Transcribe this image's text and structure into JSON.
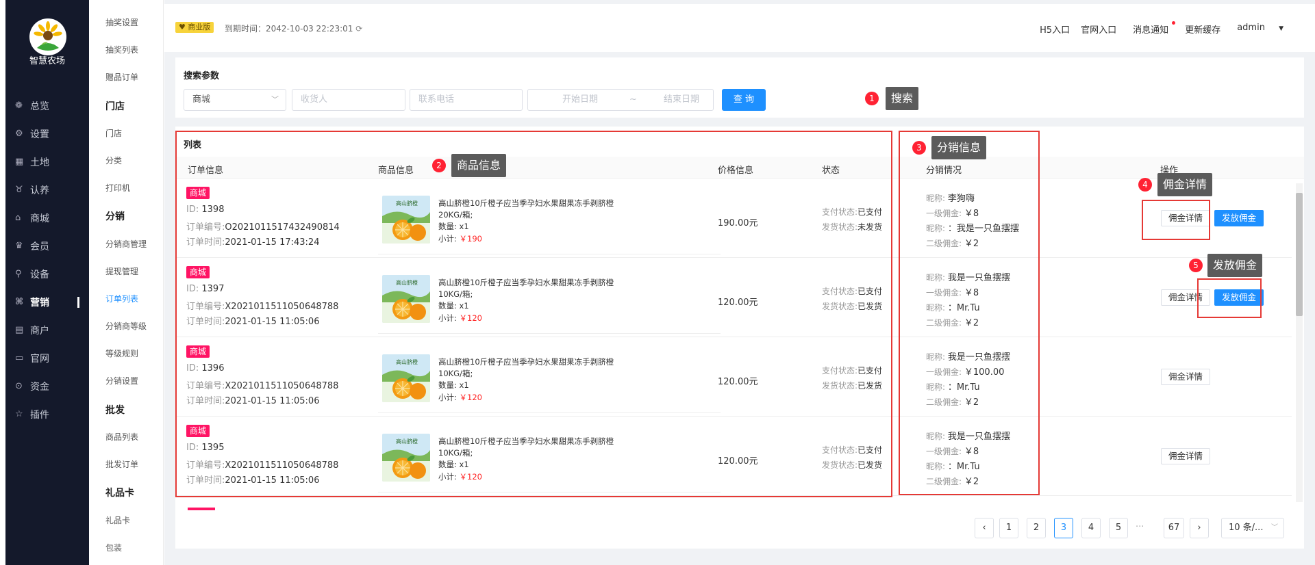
{
  "app": {
    "name": "智慧农场"
  },
  "sidebar": {
    "items": [
      {
        "icon": "dashboard-icon",
        "glyph": "❁",
        "label": "总览"
      },
      {
        "icon": "gear-icon",
        "glyph": "⚙",
        "label": "设置"
      },
      {
        "icon": "grid-icon",
        "glyph": "▦",
        "label": "土地"
      },
      {
        "icon": "animal-icon",
        "glyph": "♉",
        "label": "认养"
      },
      {
        "icon": "shop-icon",
        "glyph": "⌂",
        "label": "商城"
      },
      {
        "icon": "crown-icon",
        "glyph": "♛",
        "label": "会员"
      },
      {
        "icon": "device-icon",
        "glyph": "⚲",
        "label": "设备"
      },
      {
        "icon": "marketing-icon",
        "glyph": "⌘",
        "label": "营销"
      },
      {
        "icon": "merchant-icon",
        "glyph": "▤",
        "label": "商户"
      },
      {
        "icon": "website-icon",
        "glyph": "▭",
        "label": "官网"
      },
      {
        "icon": "money-icon",
        "glyph": "⊙",
        "label": "资金"
      },
      {
        "icon": "plugin-icon",
        "glyph": "☆",
        "label": "插件"
      }
    ],
    "active_index": 7
  },
  "subnav": {
    "items": [
      {
        "label": "抽奖设置",
        "type": "item"
      },
      {
        "label": "抽奖列表",
        "type": "item"
      },
      {
        "label": "赠品订单",
        "type": "item"
      },
      {
        "label": "门店",
        "type": "head"
      },
      {
        "label": "门店",
        "type": "item"
      },
      {
        "label": "分类",
        "type": "item"
      },
      {
        "label": "打印机",
        "type": "item"
      },
      {
        "label": "分销",
        "type": "head"
      },
      {
        "label": "分销商管理",
        "type": "item"
      },
      {
        "label": "提现管理",
        "type": "item"
      },
      {
        "label": "订单列表",
        "type": "active"
      },
      {
        "label": "分销商等级",
        "type": "item"
      },
      {
        "label": "等级规则",
        "type": "item"
      },
      {
        "label": "分销设置",
        "type": "item"
      },
      {
        "label": "批发",
        "type": "head"
      },
      {
        "label": "商品列表",
        "type": "item"
      },
      {
        "label": "批发订单",
        "type": "item"
      },
      {
        "label": "礼品卡",
        "type": "head"
      },
      {
        "label": "礼品卡",
        "type": "item"
      },
      {
        "label": "包装",
        "type": "item"
      }
    ]
  },
  "header": {
    "edition": "商业版",
    "expire_label": "到期时间：2042-10-03 22:23:01",
    "links": [
      "H5入口",
      "官网入口",
      "消息通知",
      "更新缓存",
      "admin"
    ]
  },
  "search": {
    "title": "搜索参数",
    "type_value": "商城",
    "receiver_placeholder": "收货人",
    "phone_placeholder": "联系电话",
    "start_placeholder": "开始日期",
    "range_sep": "~",
    "end_placeholder": "结束日期",
    "query_button": "查 询"
  },
  "list": {
    "title": "列表",
    "headers": {
      "order": "订单信息",
      "goods": "商品信息",
      "price": "价格信息",
      "status": "状态",
      "distribution": "分销情况",
      "actions": "操作"
    },
    "orders": [
      {
        "tag": "商城",
        "id": "1398",
        "order_no": "O2021011517432490814",
        "time": "2021-01-15 17:43:24",
        "goods_name": "高山脐橙10斤橙子应当季孕妇水果甜果冻手剥脐橙",
        "spec": "20KG/箱;",
        "qty": "x1",
        "subtotal": "￥190",
        "price": "190.00元",
        "pay_status": "已支付",
        "ship_status": "未发货",
        "d1_name": "李狗嗨",
        "d1_comm": "￥8",
        "d2_name": "：我是一只鱼摆摆",
        "d2_comm": "￥2"
      },
      {
        "tag": "商城",
        "id": "1397",
        "order_no": "X2021011511050648788",
        "time": "2021-01-15 11:05:06",
        "goods_name": "高山脐橙10斤橙子应当季孕妇水果甜果冻手剥脐橙",
        "spec": "10KG/箱;",
        "qty": "x1",
        "subtotal": "￥120",
        "price": "120.00元",
        "pay_status": "已支付",
        "ship_status": "已发货",
        "d1_name": "我是一只鱼摆摆",
        "d1_comm": "￥8",
        "d2_name": "：Mr.Tu",
        "d2_comm": "￥2"
      },
      {
        "tag": "商城",
        "id": "1396",
        "order_no": "X2021011511050648788",
        "time": "2021-01-15 11:05:06",
        "goods_name": "高山脐橙10斤橙子应当季孕妇水果甜果冻手剥脐橙",
        "spec": "10KG/箱;",
        "qty": "x1",
        "subtotal": "￥120",
        "price": "120.00元",
        "pay_status": "已支付",
        "ship_status": "已发货",
        "d1_name": "我是一只鱼摆摆",
        "d1_comm": "￥100.00",
        "d2_name": "：Mr.Tu",
        "d2_comm": "￥2"
      },
      {
        "tag": "商城",
        "id": "1395",
        "order_no": "X2021011511050648788",
        "time": "2021-01-15 11:05:06",
        "goods_name": "高山脐橙10斤橙子应当季孕妇水果甜果冻手剥脐橙",
        "spec": "10KG/箱;",
        "qty": "x1",
        "subtotal": "￥120",
        "price": "120.00元",
        "pay_status": "已支付",
        "ship_status": "已发货",
        "d1_name": "我是一只鱼摆摆",
        "d1_comm": "￥8",
        "d2_name": "：Mr.Tu",
        "d2_comm": "￥2"
      }
    ],
    "labels": {
      "id": "ID:",
      "order_no": "订单编号:",
      "time": "订单时间:",
      "qty": "数量:",
      "subtotal": "小计:",
      "pay": "支付状态:",
      "ship": "发货状态:",
      "nickname": "昵称:",
      "level1": "一级佣金:",
      "level2": "二级佣金:"
    },
    "btn_detail": "佣金详情",
    "btn_pay": "发放佣金"
  },
  "annotations": [
    {
      "num": "1",
      "text": "搜索"
    },
    {
      "num": "2",
      "text": "商品信息"
    },
    {
      "num": "3",
      "text": "分销信息"
    },
    {
      "num": "4",
      "text": "佣金详情"
    },
    {
      "num": "5",
      "text": "发放佣金"
    }
  ],
  "pagination": {
    "pages": [
      "1",
      "2",
      "3",
      "4",
      "5"
    ],
    "current": "3",
    "ellipsis": "···",
    "last": "67",
    "page_size": "10 条/..."
  },
  "colors": {
    "sidebar_bg": "#14192b",
    "accent": "#1e90ff",
    "tag": "#ff1464",
    "annotation_red": "#e53935",
    "callout_bg": "#5b5b5b",
    "vip_badge": "#f7d33b"
  }
}
